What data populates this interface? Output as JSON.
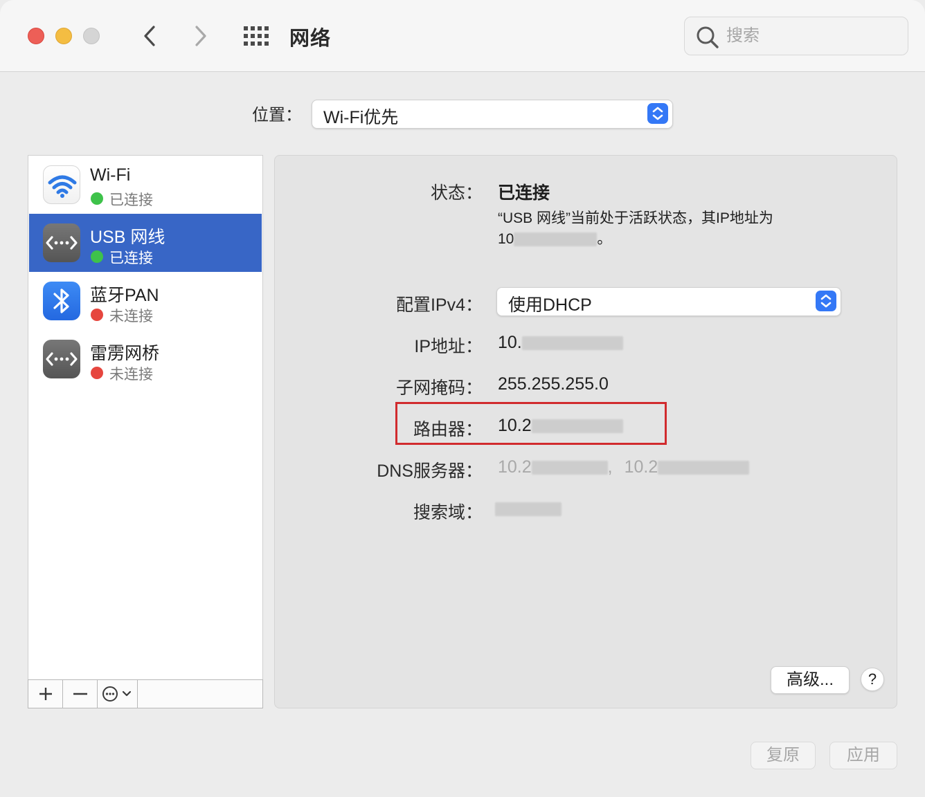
{
  "window": {
    "title": "网络",
    "search_placeholder": "搜索"
  },
  "location": {
    "label": "位置：",
    "value": "Wi-Fi优先"
  },
  "services": [
    {
      "name": "Wi-Fi",
      "status": "已连接",
      "status_color": "#3ec24a",
      "icon": "wifi-icon"
    },
    {
      "name": "USB 网线",
      "status": "已连接",
      "status_color": "#3ec24a",
      "icon": "ethernet-icon",
      "selected": true
    },
    {
      "name": "蓝牙PAN",
      "status": "未连接",
      "status_color": "#e6463e",
      "icon": "bluetooth-icon"
    },
    {
      "name": "雷雳网桥",
      "status": "未连接",
      "status_color": "#e6463e",
      "icon": "ethernet-icon"
    }
  ],
  "detail": {
    "status_label": "状态：",
    "status_value": "已连接",
    "description_line1": "“USB 网线”当前处于活跃状态，其IP地址为",
    "description_line2_prefix": "10",
    "description_line2_suffix": "。",
    "ipv4_label": "配置IPv4：",
    "ipv4_value": "使用DHCP",
    "ip_label": "IP地址：",
    "ip_value_prefix": "10.",
    "subnet_label": "子网掩码：",
    "subnet_value": "255.255.255.0",
    "router_label": "路由器：",
    "router_value_prefix": "10.2",
    "dns_label": "DNS服务器：",
    "dns_value1_prefix": "10.2",
    "dns_sep": ",",
    "dns_value2_prefix": "10.2",
    "search_domain_label": "搜索域：",
    "advanced_button": "高级...",
    "help_button": "?"
  },
  "footer": {
    "revert_button": "复原",
    "apply_button": "应用"
  },
  "colors": {
    "accent": "#3478f6",
    "selection": "#3866c6",
    "highlight_box": "#d12b2e"
  }
}
